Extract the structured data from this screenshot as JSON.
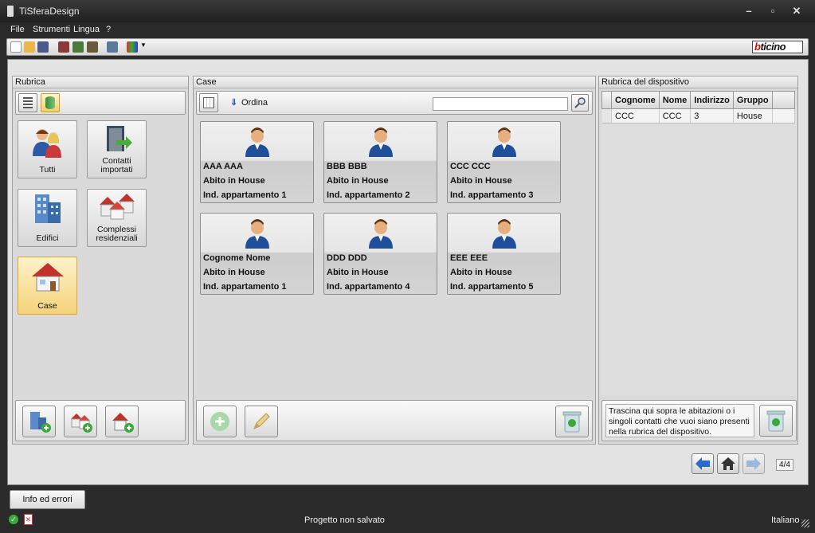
{
  "window": {
    "title": "TiSferaDesign"
  },
  "menu": {
    "items": [
      "File",
      "Strumenti",
      "Lingua",
      "?"
    ]
  },
  "brand": {
    "logo_text": "bticino",
    "accent": "#d20a0a"
  },
  "rubrica": {
    "title": "Rubrica",
    "tiles": [
      {
        "label": "Tutti",
        "icon": "people-icon"
      },
      {
        "label": "Contatti importati",
        "icon": "import-door-icon"
      },
      {
        "label": "Edifici",
        "icon": "building-icon"
      },
      {
        "label": "Complessi residenziali",
        "icon": "houses-complex-icon"
      },
      {
        "label": "Case",
        "icon": "house-icon",
        "selected": true
      }
    ]
  },
  "case": {
    "title": "Case",
    "sort_label": "Ordina",
    "search_value": "",
    "cards": [
      {
        "name": "AAA AAA",
        "group": "Abito in House",
        "apartment": "Ind. appartamento 1"
      },
      {
        "name": "BBB BBB",
        "group": "Abito in House",
        "apartment": "Ind. appartamento 2"
      },
      {
        "name": "CCC CCC",
        "group": "Abito in House",
        "apartment": "Ind. appartamento 3"
      },
      {
        "name": "Cognome Nome",
        "group": "Abito in House",
        "apartment": "Ind. appartamento 1"
      },
      {
        "name": "DDD DDD",
        "group": "Abito in House",
        "apartment": "Ind. appartamento 4"
      },
      {
        "name": "EEE EEE",
        "group": "Abito in House",
        "apartment": "Ind. appartamento 5"
      }
    ]
  },
  "device_book": {
    "title": "Rubrica del dispositivo",
    "columns": [
      "Cognome",
      "Nome",
      "Indirizzo",
      "Gruppo"
    ],
    "rows": [
      [
        "CCC",
        "CCC",
        "3",
        "House"
      ]
    ],
    "drop_hint": "Trascina qui sopra le abitazioni o i singoli contatti che vuoi siano presenti nella rubrica del dispositivo."
  },
  "nav": {
    "page_indicator": "4/4"
  },
  "bottom": {
    "info_button": "Info ed errori"
  },
  "status": {
    "message": "Progetto non salvato",
    "language": "Italiano"
  }
}
